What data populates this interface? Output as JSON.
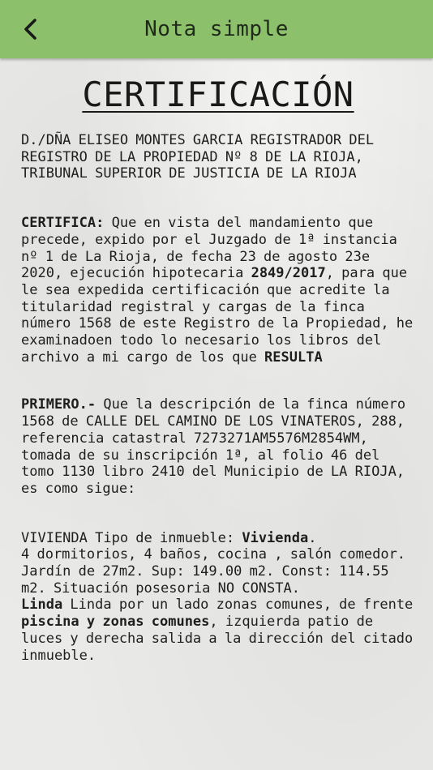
{
  "appbar": {
    "title": "Nota simple",
    "back_icon": "chevron-left-icon"
  },
  "document": {
    "heading": "CERTIFICACIÓN",
    "intro": "D./DÑA ELISEO MONTES GARCIA REGISTRADOR DEL REGISTRO DE LA PROPIEDAD Nº 8 DE LA RIOJA, TRIBUNAL SUPERIOR DE JUSTICIA DE LA RIOJA",
    "certifica": {
      "label": "CERTIFICA:",
      "text1": " Que en vista del mandamiento que precede, expido por el Juzgado de 1ª instancia nº 1 de La Rioja, de fecha 23 de agosto 23e 2020, ejecución hipotecaria ",
      "case_number": "2849/2017",
      "text2": ", para que le sea expedida certificación que acredite la titularidad registral y cargas de la finca número 1568 de este Registro de la Propiedad, he examinadoen todo lo necesario los libros del archivo a mi cargo de los que ",
      "resulta": "RESULTA"
    },
    "primero": {
      "label": "PRIMERO.-",
      "text": " Que la descripción de la finca número 1568 de CALLE DEL CAMINO DE LOS VINATEROS, 288, referencia catastral 7273271AM5576M2854WM, tomada de su inscripción 1ª, al folio 46 del tomo 1130 libro 2410 del Municipio de LA RIOJA, es como sigue:"
    },
    "vivienda": {
      "line1_prefix": "VIVIENDA Tipo de inmueble: ",
      "tipo": "Vivienda",
      "line1_suffix": ".",
      "details": "4 dormitorios, 4 baños, cocina , salón comedor.  Jardín de 27m2. Sup: 149.00 m2. Const: 114.55 m2. Situación posesoria NO CONSTA.",
      "linda_label": "Linda",
      "linda_text1": " Linda por un lado zonas comunes,  de frente ",
      "linda_bold": "piscina y zonas comunes",
      "linda_text2": ", izquierda patio de luces y derecha salida a la dirección del citado inmueble."
    }
  }
}
